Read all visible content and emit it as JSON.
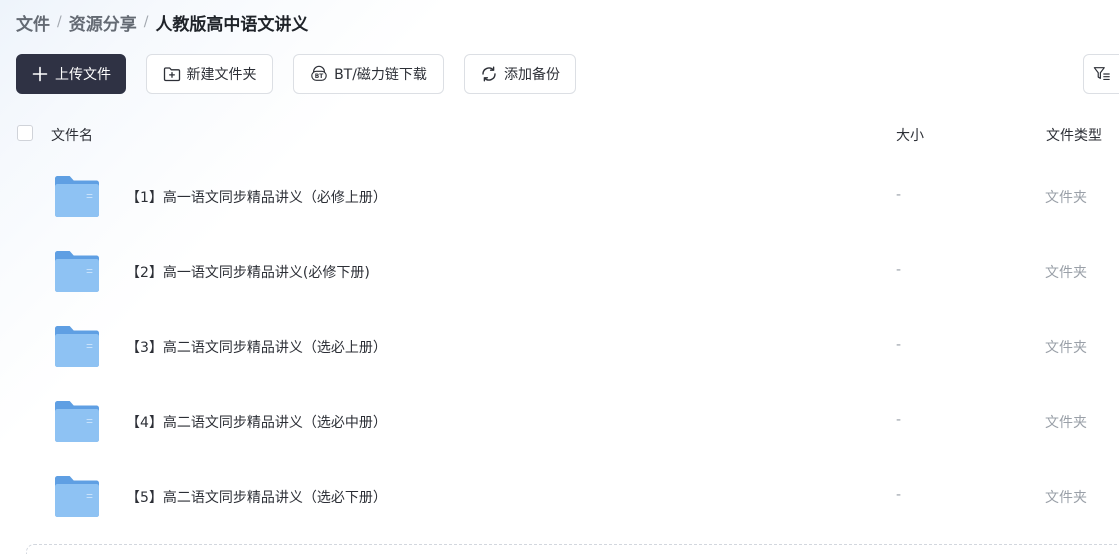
{
  "breadcrumb": {
    "items": [
      "文件",
      "资源分享",
      "人教版高中语文讲义"
    ],
    "separator": "/"
  },
  "toolbar": {
    "upload_label": "上传文件",
    "new_folder_label": "新建文件夹",
    "bt_label": "BT/磁力链下载",
    "backup_label": "添加备份"
  },
  "table": {
    "columns": {
      "name": "文件名",
      "size": "大小",
      "type": "文件类型"
    },
    "rows": [
      {
        "name": "【1】高一语文同步精品讲义（必修上册）",
        "size": "-",
        "type": "文件夹"
      },
      {
        "name": "【2】高一语文同步精品讲义(必修下册)",
        "size": "-",
        "type": "文件夹"
      },
      {
        "name": "【3】高二语文同步精品讲义（选必上册）",
        "size": "-",
        "type": "文件夹"
      },
      {
        "name": "【4】高二语文同步精品讲义（选必中册）",
        "size": "-",
        "type": "文件夹"
      },
      {
        "name": "【5】高二语文同步精品讲义（选必下册）",
        "size": "-",
        "type": "文件夹"
      }
    ]
  },
  "icons": {
    "upload": "plus-icon",
    "new_folder": "folder-plus-icon",
    "bt": "bt-icon",
    "backup": "sync-icon",
    "filter": "filter-icon",
    "row": "folder-icon"
  },
  "colors": {
    "primary_button": "#2f3244",
    "folder_blue": "#7fb6ef",
    "muted_text": "#9aa0a8"
  }
}
